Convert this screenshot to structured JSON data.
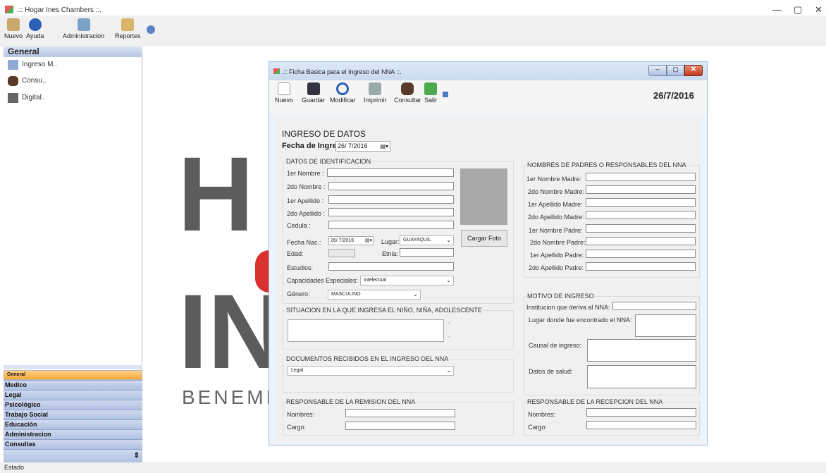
{
  "window": {
    "title": ".:: Hogar Ines Chambers ::."
  },
  "toolbar": {
    "items": [
      {
        "label": "Nuevo"
      },
      {
        "label": "Ayuda"
      },
      {
        "label": "Administracion"
      },
      {
        "label": "Reportes"
      }
    ]
  },
  "sidebar": {
    "header": "General",
    "items": [
      {
        "label": "Ingreso M.."
      },
      {
        "label": "Consu.."
      },
      {
        "label": "Digital.."
      }
    ],
    "nav": [
      "General",
      "Medico",
      "Legal",
      "Psicológico",
      "Trabajo Social",
      "Educación",
      "Administracion",
      "Consultas"
    ]
  },
  "logo": {
    "l1": "H",
    "l2": "IN",
    "l3": "BENEMÉ"
  },
  "status": "Estado",
  "dialog": {
    "title": ".:: Ficha Basica para el Ingreso del NNA ::.",
    "date": "26/7/2016",
    "toolbar": [
      {
        "label": "Nuevo"
      },
      {
        "label": "Guardar"
      },
      {
        "label": "Modificar"
      },
      {
        "label": "Imprimir"
      },
      {
        "label": "Consultar"
      },
      {
        "label": "Salir"
      }
    ],
    "section_title": "INGRESO DE DATOS",
    "fecha_label": "Fecha de Ingreso",
    "fecha_value": "26/ 7/2016",
    "datos": {
      "title": "DATOS DE IDENTIFICACION",
      "n1": "1er Nombre :",
      "n2": "2do Nombre :",
      "a1": "1er Apellido :",
      "a2": "2do Apellido :",
      "cedula": "Cedula :",
      "fnac": "Fecha Nac.:",
      "fnac_val": "26/ 7/2016",
      "lugar": "Lugar:",
      "lugar_val": "GUAYAQUIL",
      "edad": "Edad:",
      "etnia": "Etnia:",
      "estudios": "Estudios:",
      "cap": "Capacidades Especiales:",
      "cap_val": "Intelectual",
      "genero": "Género:",
      "genero_val": "MASCULINO",
      "cargar": "Cargar Foto"
    },
    "situacion": "SITUACION EN LA QUE INGRESA EL NIÑO, NIÑA, ADOLESCENTE",
    "docs": {
      "title": "DOCUMENTOS RECIBIDOS EN EL INGRESO DEL NNA",
      "val": "Legal"
    },
    "remision": {
      "title": "RESPONSABLE DE LA REMISION DEL NNA",
      "nombres": "Nombres:",
      "cargo": "Cargo:"
    },
    "padres": {
      "title": "NOMBRES DE PADRES O RESPONSABLES DEL NNA",
      "labels": [
        "1er Nombre Madre:",
        "2do Nombre Madre:",
        "1er Apellido Madre:",
        "2do Apellido Madre:",
        "1er Nombre Padre:",
        "2do Nombre Padre:",
        "1er Apellido Padre:",
        "2do Apellido Padre:"
      ]
    },
    "motivo": {
      "title": "MOTIVO DE INGRESO",
      "inst": "Institucion que deriva al NNA:",
      "lugar": "Lugar donde fue encontrado el NNA:",
      "causal": "Causal de ingreso:",
      "salud": "Datos de salud:"
    },
    "recepcion": {
      "title": "RESPONSABLE DE LA RECEPCION DEL NNA",
      "nombres": "Nombres:",
      "cargo": "Cargo:"
    }
  }
}
